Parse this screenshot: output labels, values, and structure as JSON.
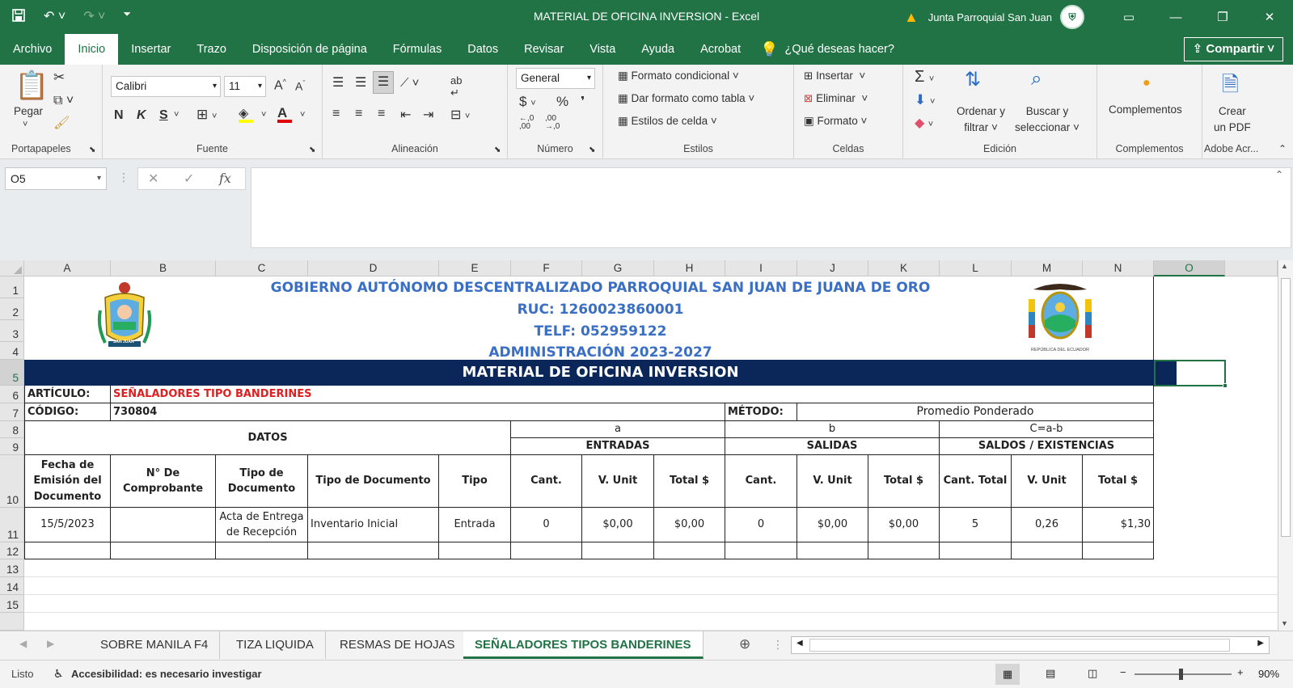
{
  "window": {
    "title": "MATERIAL DE OFICINA INVERSION  -  Excel",
    "user": "Junta Parroquial San Juan"
  },
  "menu": {
    "items": [
      "Archivo",
      "Inicio",
      "Insertar",
      "Trazo",
      "Disposición de página",
      "Fórmulas",
      "Datos",
      "Revisar",
      "Vista",
      "Ayuda",
      "Acrobat"
    ],
    "tell_me": "¿Qué deseas hacer?",
    "share": "Compartir"
  },
  "ribbon": {
    "clipboard": {
      "paste": "Pegar",
      "label": "Portapapeles"
    },
    "font": {
      "name": "Calibri",
      "size": "11",
      "bold": "N",
      "italic": "K",
      "underline": "S",
      "label": "Fuente"
    },
    "alignment": {
      "label": "Alineación"
    },
    "number": {
      "format": "General",
      "label": "Número"
    },
    "styles": {
      "conditional": "Formato condicional",
      "table": "Dar formato como tabla",
      "cell_styles": "Estilos de celda",
      "label": "Estilos"
    },
    "cells": {
      "insert": "Insertar",
      "delete": "Eliminar",
      "format": "Formato",
      "label": "Celdas"
    },
    "editing": {
      "sort1": "Ordenar y",
      "sort2": "filtrar",
      "find1": "Buscar y",
      "find2": "seleccionar",
      "label": "Edición"
    },
    "addins": {
      "button": "Complementos",
      "label": "Complementos"
    },
    "adobe": {
      "line1": "Crear",
      "line2": "un PDF",
      "label": "Adobe Acr..."
    }
  },
  "formula_bar": {
    "name_box": "O5",
    "fx": "fx",
    "content": ""
  },
  "columns": [
    "A",
    "B",
    "C",
    "D",
    "E",
    "F",
    "G",
    "H",
    "I",
    "J",
    "K",
    "L",
    "M",
    "N",
    "O"
  ],
  "rows": [
    "1",
    "2",
    "3",
    "4",
    "5",
    "6",
    "7",
    "8",
    "9",
    "10",
    "11",
    "12",
    "13",
    "14",
    "15"
  ],
  "sheet": {
    "header_lines": [
      "GOBIERNO AUTÓNOMO DESCENTRALIZADO PARROQUIAL SAN JUAN DE JUANA DE ORO",
      "RUC: 1260023860001",
      "TELF: 052959122",
      "ADMINISTRACIÓN 2023-2027"
    ],
    "banner": "MATERIAL DE OFICINA INVERSION",
    "article_label": "ARTÍCULO:",
    "article_value": "SEÑALADORES TIPO BANDERINES",
    "code_label": "CÓDIGO:",
    "code_value": "730804",
    "method_label": "MÉTODO:",
    "method_value": "Promedio Ponderado",
    "datos": "DATOS",
    "a": "a",
    "b": "b",
    "c": "C=a-b",
    "entradas": "ENTRADAS",
    "salidas": "SALIDAS",
    "saldos": "SALDOS / EXISTENCIAS",
    "headers": [
      "Fecha de Emisión del Documento",
      "N° De Comprobante",
      "Tipo de Documento",
      "Tipo de Documento",
      "Tipo",
      "Cant.",
      "V. Unit",
      "Total $",
      "Cant.",
      "V. Unit",
      "Total $",
      "Cant. Total",
      "V. Unit",
      "Total $"
    ],
    "row11": [
      "15/5/2023",
      "",
      "Acta de Entrega de Recepción",
      "Inventario Inicial",
      "Entrada",
      "0",
      "$0,00",
      "$0,00",
      "0",
      "$0,00",
      "$0,00",
      "5",
      "0,26",
      "$1,30"
    ],
    "logo_left_text": "SAN JUAN",
    "logo_right_text": "REPÚBLICA DEL ECUADOR"
  },
  "tabs": [
    "SOBRE MANILA F4",
    "TIZA LIQUIDA",
    "RESMAS DE HOJAS",
    "SEÑALADORES TIPOS BANDERINES"
  ],
  "status": {
    "ready": "Listo",
    "accessibility": "Accesibilidad: es necesario investigar",
    "zoom": "90%"
  },
  "colors": {
    "excel_green": "#217346",
    "banner": "#0b2659",
    "header_blue": "#3a6fc4",
    "red_text": "#e02020"
  }
}
